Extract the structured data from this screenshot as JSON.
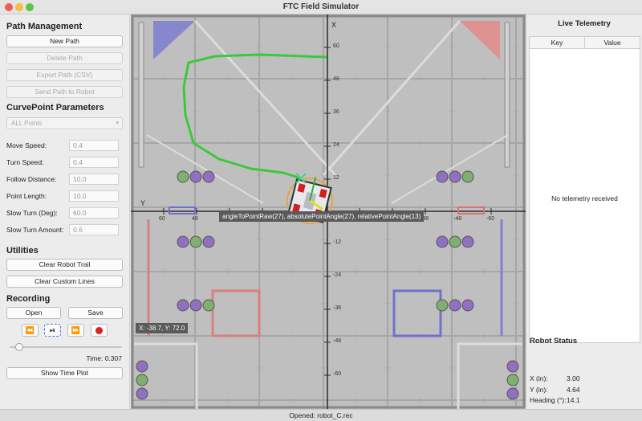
{
  "window": {
    "title": "FTC Field Simulator"
  },
  "left": {
    "path_mgmt": {
      "title": "Path Management",
      "new_path": "New Path",
      "delete_path": "Delete Path",
      "export_path": "Export Path (CSV)",
      "send_path": "Send Path to Robot"
    },
    "curve": {
      "title": "CurvePoint Parameters",
      "selector": "ALL Points",
      "params": [
        {
          "label": "Move Speed:",
          "value": "0.4"
        },
        {
          "label": "Turn Speed:",
          "value": "0.4"
        },
        {
          "label": "Follow Distance:",
          "value": "10.0"
        },
        {
          "label": "Point Length:",
          "value": "10.0"
        },
        {
          "label": "Slow Turn (Deg):",
          "value": "60.0"
        },
        {
          "label": "Slow Turn Amount:",
          "value": "0.6"
        }
      ]
    },
    "utilities": {
      "title": "Utilities",
      "clear_trail": "Clear Robot Trail",
      "clear_lines": "Clear Custom Lines"
    },
    "recording": {
      "title": "Recording",
      "open": "Open",
      "save": "Save",
      "time": "Time: 0.307",
      "show_plot": "Show Time Plot",
      "progress": 0.05
    }
  },
  "field": {
    "axis_x": "X",
    "axis_y": "Y",
    "x_ticks": [
      "60",
      "48",
      "36",
      "24",
      "12",
      "-12",
      "-24",
      "-36",
      "-48",
      "-60"
    ],
    "y_ticks": [
      "60",
      "48",
      "36",
      "24",
      "12",
      "-12",
      "-24",
      "-36",
      "-48",
      "-60"
    ],
    "coords": "X: -38.7, Y: 72.0",
    "tooltip": "angleToPointRaw(27), absolutePointAngle(27), relativePointAngle(13)",
    "colors": {
      "path": "#38c838",
      "red": "#e06060",
      "blue": "#7070cc",
      "purple": "#9060c0",
      "green_ball": "#60b050"
    }
  },
  "telemetry": {
    "title": "Live Telemetry",
    "col_key": "Key",
    "col_value": "Value",
    "empty": "No telemetry received"
  },
  "robot_status": {
    "title": "Robot Status",
    "x_label": "X (in):",
    "x_value": "3.00",
    "y_label": "Y (in):",
    "y_value": "4.64",
    "heading_label": "Heading (°):",
    "heading_value": "14.1"
  },
  "status_bar": {
    "text": "Opened: robot_C.rec"
  }
}
